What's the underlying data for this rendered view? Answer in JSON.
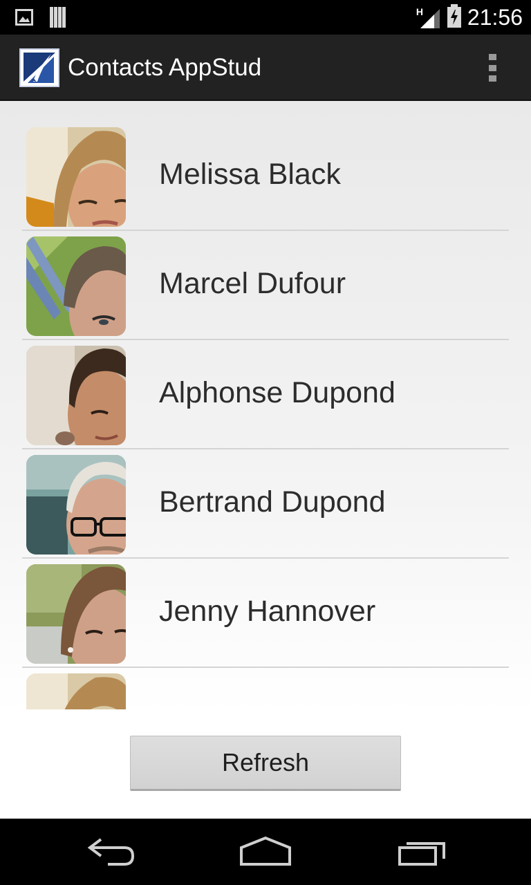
{
  "status_bar": {
    "time": "21:56",
    "network_type": "H",
    "icons": [
      "image-notification-icon",
      "storage-notification-icon",
      "signal-icon",
      "battery-charging-icon"
    ]
  },
  "action_bar": {
    "title": "Contacts AppStud",
    "logo_icon": "appstud-logo-icon",
    "overflow_icon": "overflow-menu-icon"
  },
  "contacts": [
    {
      "name": "Melissa Black",
      "avatar": "contact-photo-woman-blonde"
    },
    {
      "name": "Marcel Dufour",
      "avatar": "contact-photo-man-dark-hair"
    },
    {
      "name": "Alphonse Dupond",
      "avatar": "contact-photo-man-brown-hair"
    },
    {
      "name": "Bertrand Dupond",
      "avatar": "contact-photo-man-glasses"
    },
    {
      "name": "Jenny Hannover",
      "avatar": "contact-photo-woman-brunette"
    }
  ],
  "partial_row_avatar": "contact-photo-woman-blonde",
  "refresh_button": {
    "label": "Refresh"
  },
  "nav_bar": {
    "icons": [
      "back-icon",
      "home-icon",
      "recent-apps-icon"
    ]
  },
  "colors": {
    "action_bar_bg": "#222222",
    "status_bar_bg": "#000000",
    "list_text": "#2c2c2c",
    "divider": "#d4d4d4",
    "button_bg": "#d6d6d6"
  }
}
